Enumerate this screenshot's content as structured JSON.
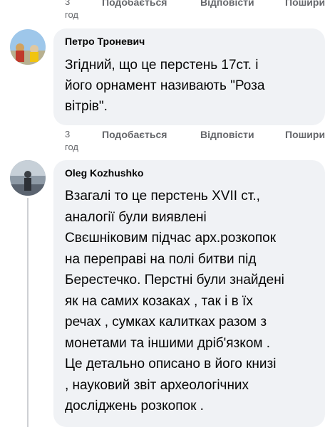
{
  "top_actions": {
    "time_line1": "3",
    "time_line2": "год",
    "like_label": "Подобається",
    "reply_label": "Відповісти",
    "share_label": "Поширити"
  },
  "comments": [
    {
      "author": "Петро Троневич",
      "text_lines": [
        "Згідний, що це перстень 17ст. і",
        "його орнамент називають \"Роза",
        "вітрів\"."
      ],
      "actions": {
        "time_line1": "3",
        "time_line2": "год",
        "like_label": "Подобається",
        "reply_label": "Відповісти",
        "share_label": "Поширити"
      }
    },
    {
      "author": "Oleg Kozhushko",
      "text_lines": [
        "Взагалі то це перстень XVII ст.,",
        "аналогії були виявлені",
        "Свєшніковим підчас арх.розкопок",
        "на переправі на полі битви під",
        "Берестечко. Перстні були знайдені",
        "як на самих козаках , так і в їх",
        "речах , сумках калитках разом з",
        "монетами та іншими дріб'язком .",
        "Це детально описано в його книзі",
        ", науковий звіт археологічних",
        "досліджень розкопок ."
      ]
    }
  ],
  "colors": {
    "bubble_bg": "#f0f2f5",
    "meta_text": "#65676b",
    "text": "#050505",
    "thread_line": "#ced0d4"
  }
}
